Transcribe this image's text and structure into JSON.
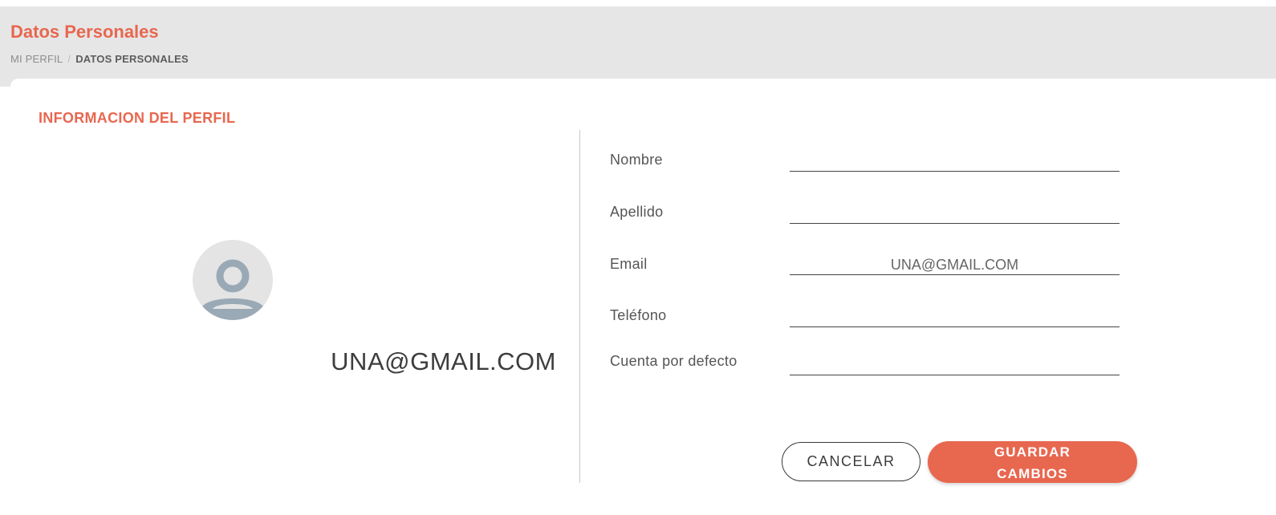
{
  "header": {
    "title": "Datos Personales",
    "breadcrumb": {
      "parent": "MI PERFIL",
      "separator": "/",
      "current": "DATOS PERSONALES"
    }
  },
  "profile": {
    "section_title": "INFORMACION DEL PERFIL",
    "avatar_icon": "user-icon",
    "email_display": "UNA@GMAIL.COM"
  },
  "form": {
    "nombre": {
      "label": "Nombre",
      "value": ""
    },
    "apellido": {
      "label": "Apellido",
      "value": ""
    },
    "email": {
      "label": "Email",
      "value": "UNA@GMAIL.COM"
    },
    "telefono": {
      "label": "Teléfono",
      "value": ""
    },
    "cuenta": {
      "label": "Cuenta por defecto",
      "value": ""
    }
  },
  "actions": {
    "cancel_label": "CANCELAR",
    "save_label": "GUARDAR CAMBIOS"
  },
  "colors": {
    "accent": "#e8674f",
    "header_bg": "#e6e6e6",
    "avatar_icon": "#9aa9b6"
  }
}
